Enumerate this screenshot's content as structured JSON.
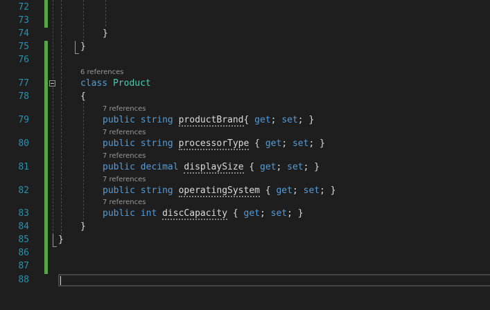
{
  "line_numbers": [
    "72",
    "73",
    "74",
    "75",
    "76",
    "77",
    "78",
    "79",
    "80",
    "81",
    "82",
    "83",
    "84",
    "85",
    "86",
    "87",
    "88"
  ],
  "code": {
    "brace_close_inner": "}",
    "brace_close_outer": "}",
    "class_ref": "6 references",
    "class_kw": "class",
    "class_name": "Product",
    "open_brace": "{",
    "members": [
      {
        "ref": "7 references",
        "mod": "public",
        "type": "string",
        "name": "productBrand",
        "rest": "{ get; set; }",
        "get": "get",
        "set": "set"
      },
      {
        "ref": "7 references",
        "mod": "public",
        "type": "string",
        "name": "processorType",
        "rest": "{ get; set; }",
        "get": "get",
        "set": "set"
      },
      {
        "ref": "7 references",
        "mod": "public",
        "type": "decimal",
        "name": "displaySize",
        "rest": "{ get; set; }",
        "get": "get",
        "set": "set"
      },
      {
        "ref": "7 references",
        "mod": "public",
        "type": "string",
        "name": "operatingSystem",
        "rest": "{ get; set; }",
        "get": "get",
        "set": "set"
      },
      {
        "ref": "7 references",
        "mod": "public",
        "type": "int",
        "name": "discCapacity",
        "rest": "{ get; set; }",
        "get": "get",
        "set": "set"
      }
    ],
    "class_close": "}",
    "namespace_close": "}"
  },
  "colors": {
    "background": "#1e1e1e",
    "line_number": "#2b91af",
    "keyword": "#569cd6",
    "type": "#4ec9b0",
    "change_bar": "#57a64a"
  }
}
